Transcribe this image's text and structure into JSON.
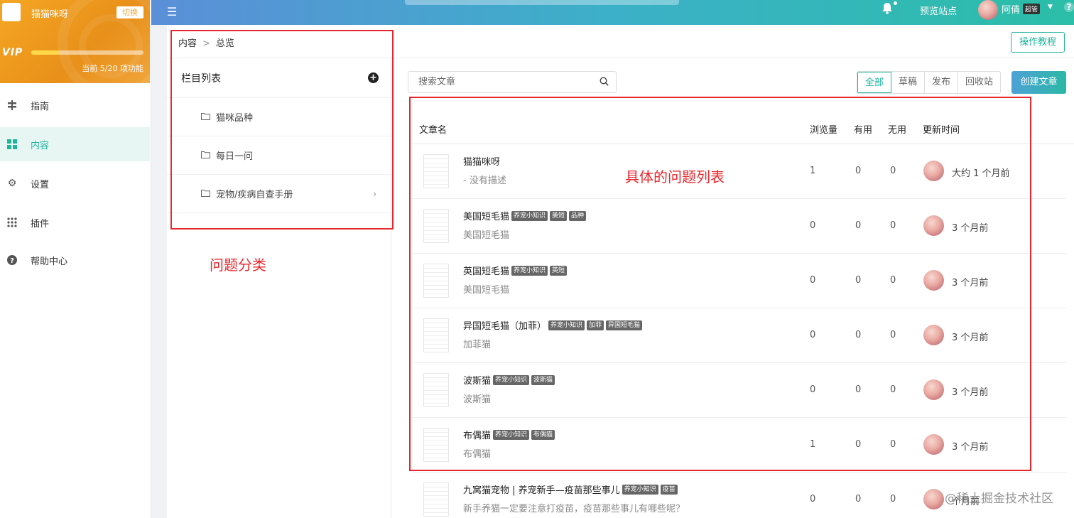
{
  "site": {
    "name": "猫猫咪呀",
    "switch_label": "切换",
    "vip_label": "VIP",
    "vip_progress_text": "当前 5/20 项功能",
    "vip_progress_fraction": 0.25
  },
  "nav": [
    {
      "label": "指南",
      "icon": "signpost-icon"
    },
    {
      "label": "内容",
      "icon": "grid-icon",
      "active": true
    },
    {
      "label": "设置",
      "icon": "gear-icon"
    },
    {
      "label": "插件",
      "icon": "dots-grid-icon"
    },
    {
      "label": "帮助中心",
      "icon": "question-circle-icon"
    }
  ],
  "header": {
    "preview_label": "预览站点",
    "user_name": "阿倩",
    "user_role": "超管"
  },
  "breadcrumb": {
    "root": "内容",
    "sep": ">",
    "current": "总览"
  },
  "tutorial_label": "操作教程",
  "columns": {
    "title": "栏目列表",
    "items": [
      {
        "label": "猫咪品种"
      },
      {
        "label": "每日一问"
      },
      {
        "label": "宠物/疾病自查手册",
        "has_children": true
      }
    ]
  },
  "annotations": {
    "category": "问题分类",
    "list": "具体的问题列表"
  },
  "search": {
    "placeholder": "搜索文章"
  },
  "filters": [
    {
      "label": "全部",
      "active": true
    },
    {
      "label": "草稿"
    },
    {
      "label": "发布"
    },
    {
      "label": "回收站"
    }
  ],
  "create_label": "创建文章",
  "table": {
    "headers": {
      "name": "文章名",
      "views": "浏览量",
      "useful": "有用",
      "useless": "无用",
      "updated": "更新时间"
    },
    "rows": [
      {
        "title": "猫猫咪呀",
        "tags": [],
        "desc": "- 没有描述",
        "views": "1",
        "useful": "0",
        "useless": "0",
        "updated": "大约 1 个月前"
      },
      {
        "title": "美国短毛猫",
        "tags": [
          "养宠小知识",
          "美短",
          "品种"
        ],
        "desc": "美国短毛猫",
        "views": "0",
        "useful": "0",
        "useless": "0",
        "updated": "3 个月前"
      },
      {
        "title": "英国短毛猫",
        "tags": [
          "养宠小知识",
          "英短"
        ],
        "desc": "美国短毛猫",
        "views": "0",
        "useful": "0",
        "useless": "0",
        "updated": "3 个月前"
      },
      {
        "title": "异国短毛猫（加菲）",
        "tags": [
          "养宠小知识",
          "加菲",
          "异国短毛猫"
        ],
        "desc": "加菲猫",
        "views": "0",
        "useful": "0",
        "useless": "0",
        "updated": "3 个月前"
      },
      {
        "title": "波斯猫",
        "tags": [
          "养宠小知识",
          "波斯猫"
        ],
        "desc": "波斯猫",
        "views": "0",
        "useful": "0",
        "useless": "0",
        "updated": "3 个月前"
      },
      {
        "title": "布偶猫",
        "tags": [
          "养宠小知识",
          "布偶猫"
        ],
        "desc": "布偶猫",
        "views": "1",
        "useful": "0",
        "useless": "0",
        "updated": "3 个月前"
      },
      {
        "title": "九窝猫宠物 | 养宠新手—疫苗那些事儿",
        "tags": [
          "养宠小知识",
          "疫苗"
        ],
        "desc": "新手养猫一定要注意打疫苗，疫苗那些事儿有哪些呢？",
        "views": "0",
        "useful": "0",
        "useless": "0",
        "updated": "个月前"
      }
    ]
  },
  "watermark": "@稀土掘金技术社区",
  "colors": {
    "accent": "#1fb49b",
    "annotation": "#e8262d",
    "vip": "#f0a53a"
  }
}
